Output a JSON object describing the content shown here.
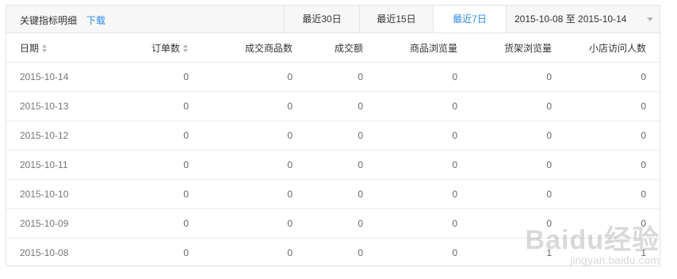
{
  "toolbar": {
    "title": "关键指标明细",
    "download_label": "下载",
    "ranges": [
      {
        "label": "最近30日",
        "active": false
      },
      {
        "label": "最近15日",
        "active": false
      },
      {
        "label": "最近7日",
        "active": true
      }
    ],
    "date_range": "2015-10-08 至 2015-10-14"
  },
  "table": {
    "headers": [
      "日期",
      "订单数",
      "成交商品数",
      "成交额",
      "商品浏览量",
      "货架浏览量",
      "小店访问人数"
    ],
    "rows": [
      [
        "2015-10-14",
        "0",
        "0",
        "0",
        "0",
        "0",
        "0"
      ],
      [
        "2015-10-13",
        "0",
        "0",
        "0",
        "0",
        "0",
        "0"
      ],
      [
        "2015-10-12",
        "0",
        "0",
        "0",
        "0",
        "0",
        "0"
      ],
      [
        "2015-10-11",
        "0",
        "0",
        "0",
        "0",
        "0",
        "0"
      ],
      [
        "2015-10-10",
        "0",
        "0",
        "0",
        "0",
        "0",
        "0"
      ],
      [
        "2015-10-09",
        "0",
        "0",
        "0",
        "0",
        "0",
        "0"
      ],
      [
        "2015-10-08",
        "0",
        "0",
        "0",
        "0",
        "1",
        "1"
      ]
    ]
  },
  "watermark": {
    "logo": "Baidu经验",
    "url": "jingyan.baidu.com"
  },
  "colors": {
    "accent": "#2a8ae6",
    "toolbar_bg": "#f7f7f7",
    "border": "#e3e3e3"
  }
}
